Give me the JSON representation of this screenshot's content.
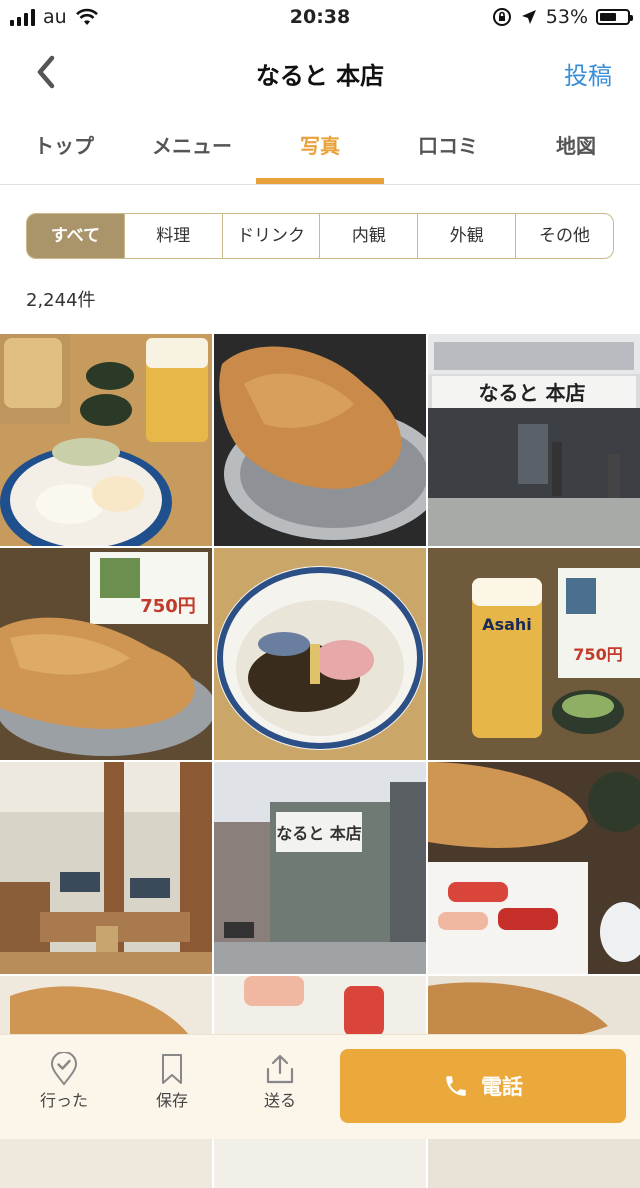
{
  "status": {
    "carrier": "au",
    "time": "20:38",
    "battery": "53%"
  },
  "header": {
    "title": "なると 本店",
    "post_label": "投稿"
  },
  "tabs": [
    {
      "label": "トップ"
    },
    {
      "label": "メニュー"
    },
    {
      "label": "写真",
      "active": true
    },
    {
      "label": "口コミ"
    },
    {
      "label": "地図"
    }
  ],
  "filters": [
    {
      "label": "すべて",
      "active": true
    },
    {
      "label": "料理"
    },
    {
      "label": "ドリンク"
    },
    {
      "label": "内観"
    },
    {
      "label": "外観"
    },
    {
      "label": "その他"
    }
  ],
  "photo_count": "2,244件",
  "photos": {
    "p3_sign": "なると 本店",
    "p4_price": "750円",
    "p6_beer": "Asahi",
    "p6_price": "750円",
    "p8_sign": "なると 本店"
  },
  "bottom": {
    "went_label": "行った",
    "save_label": "保存",
    "send_label": "送る",
    "call_label": "電話"
  },
  "colors": {
    "accent": "#e9a23b",
    "segment_active": "#a99569",
    "link": "#3a8fd6"
  }
}
